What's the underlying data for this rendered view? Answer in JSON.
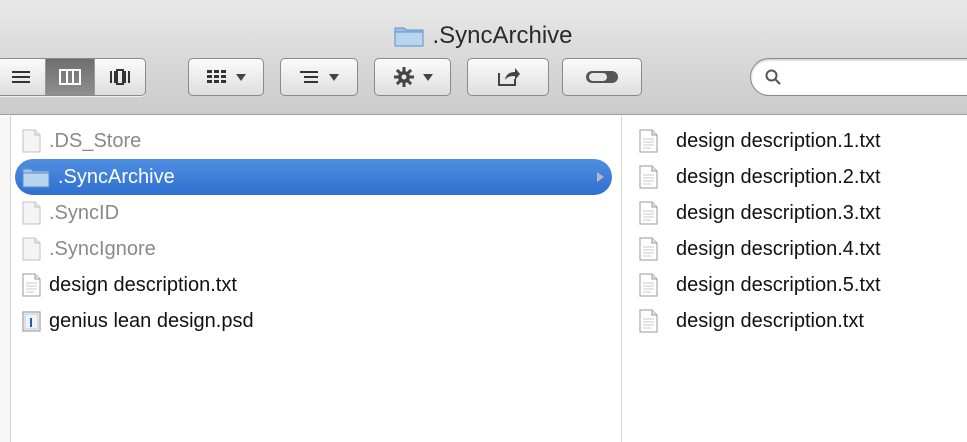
{
  "window": {
    "title": ".SyncArchive"
  },
  "toolbar": {
    "view_buttons": [
      {
        "icon": "list-view-icon",
        "active": false
      },
      {
        "icon": "column-view-icon",
        "active": true
      },
      {
        "icon": "cover-flow-icon",
        "active": false
      }
    ],
    "arrange_icon": "arrange-grid-icon",
    "sort_icon": "sort-lines-icon",
    "action_icon": "gear-icon",
    "share_icon": "share-icon",
    "tag_icon": "toggle-pill-icon",
    "search": {
      "value": "",
      "placeholder": ""
    }
  },
  "left_column": {
    "items": [
      {
        "name": ".DS_Store",
        "kind": "document",
        "hidden": true,
        "selected": false
      },
      {
        "name": ".SyncArchive",
        "kind": "folder",
        "hidden": true,
        "selected": true
      },
      {
        "name": ".SyncID",
        "kind": "document",
        "hidden": true,
        "selected": false
      },
      {
        "name": ".SyncIgnore",
        "kind": "document",
        "hidden": true,
        "selected": false
      },
      {
        "name": "design description.txt",
        "kind": "document",
        "hidden": false,
        "selected": false
      },
      {
        "name": "genius lean design.psd",
        "kind": "psd-document",
        "hidden": false,
        "selected": false
      }
    ]
  },
  "right_column": {
    "items": [
      {
        "name": "design description.1.txt",
        "kind": "document"
      },
      {
        "name": "design description.2.txt",
        "kind": "document"
      },
      {
        "name": "design description.3.txt",
        "kind": "document"
      },
      {
        "name": "design description.4.txt",
        "kind": "document"
      },
      {
        "name": "design description.5.txt",
        "kind": "document"
      },
      {
        "name": "design description.txt",
        "kind": "document"
      }
    ]
  },
  "colors": {
    "selection": "#3b7ddb",
    "hidden_text": "#8a8a8a",
    "folder_blue": "#9cc3e8"
  }
}
